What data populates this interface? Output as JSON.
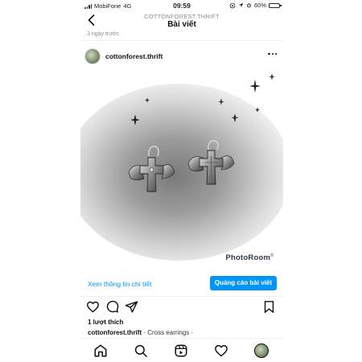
{
  "status_bar": {
    "carrier": "MobiFone",
    "network": "4G",
    "time": "09:59",
    "battery": "60%",
    "battery_level": 0.6
  },
  "header": {
    "subtitle": "COTTONFOREST.THRIFT",
    "title": "Bài viết",
    "back_icon": "chevron-left-icon"
  },
  "previous_post": {
    "timestamp": "3 ngày trước"
  },
  "post": {
    "author": "cottonforest.thrift",
    "more_icon": "more-horizontal-icon",
    "image": {
      "subject": "winged cross earrings",
      "watermark": "PhotoRoom",
      "watermark_mark": "®",
      "background_color": "#a9a9a9"
    },
    "view_insights": "Xem thông tin chi tiết",
    "promote_button": "Quảng cáo bài viết",
    "likes": "1 lượt thích",
    "caption_author": "cottonforest.thrift",
    "caption_text": " · Cross earrings ·"
  },
  "actions": {
    "like_icon": "heart-icon",
    "comment_icon": "comment-icon",
    "share_icon": "send-icon",
    "save_icon": "bookmark-icon"
  },
  "bottom_nav": {
    "items": [
      "home-icon",
      "search-icon",
      "reels-icon",
      "activity-heart-icon",
      "profile-avatar"
    ]
  },
  "colors": {
    "accent": "#0095f6",
    "muted": "#8e8e8e",
    "text": "#111111"
  }
}
